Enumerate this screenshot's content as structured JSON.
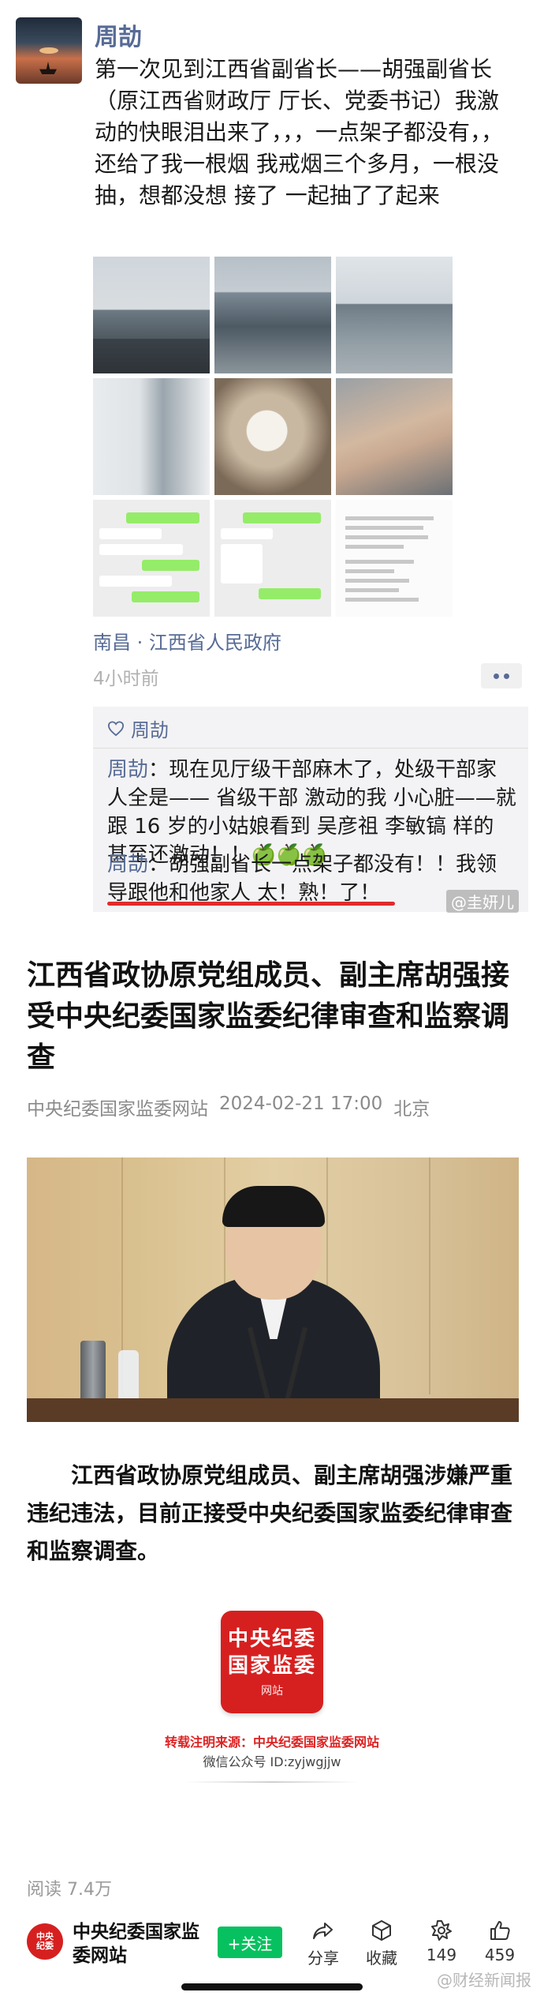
{
  "moment": {
    "author": "周劼",
    "text": "第一次见到江西省副省长——胡强副省长（原江西省财政厅 厅长、党委书记）我激动的快眼泪出来了，，，一点架子都没有，，还给了我一根烟  我戒烟三个多月，一根没抽，想都没想 接了 一起抽了了起来",
    "location": "南昌 · 江西省人民政府",
    "time_ago": "4小时前",
    "likes_name": "周劼",
    "comments": [
      {
        "who": "周劼",
        "text": "现在见厅级干部麻木了，处级干部家人全是—— 省级干部  激动的我  小心脏——就跟 16 岁的小姑娘看到 吴彦祖 李敏镐 样的   甚至还激动！！🍏🍏🍏"
      },
      {
        "who": "周劼",
        "text": "胡强副省长一点架子都没有！！我领导跟他和他家人  太！熟！了！"
      }
    ],
    "watermark": "@圭妍儿"
  },
  "article": {
    "title": "江西省政协原党组成员、副主席胡强接受中央纪委国家监委纪律审查和监察调查",
    "source": "中央纪委国家监委网站",
    "datetime": "2024-02-21 17:00",
    "place": "北京",
    "lead": "江西省政协原党组成员、副主席胡强涉嫌严重违纪违法，目前正接受中央纪委国家监委纪律审查和监察调查。",
    "seal": {
      "line1": "中央纪委",
      "line2": "国家监委",
      "line3": "网站"
    },
    "repost_note": "转载注明来源：中央纪委国家监委网站",
    "wechat_id": "微信公众号 ID:zyjwgjjw",
    "reads": "阅读 7.4万"
  },
  "bottom_bar": {
    "account_name": "中央纪委国家监委网站",
    "follow_label": "+关注",
    "share_label": "分享",
    "favorite_label": "收藏",
    "recommend_count": "149",
    "like_count": "459",
    "watermark": "@财经新闻报"
  },
  "colors": {
    "link_blue": "#576b95",
    "wechat_green": "#07c160",
    "seal_red": "#d62020"
  }
}
